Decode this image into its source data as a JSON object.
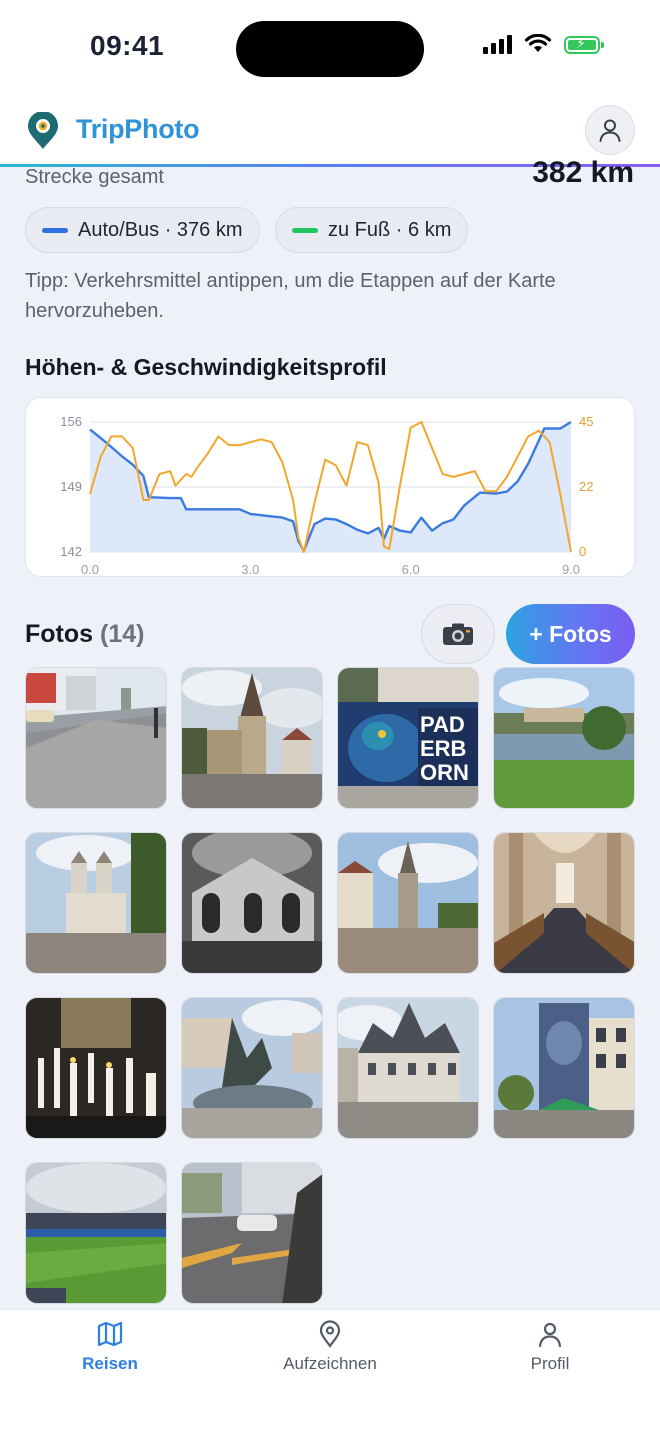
{
  "status_bar": {
    "time": "09:41"
  },
  "header": {
    "app_name": "TripPhoto"
  },
  "distance": {
    "label": "Strecke gesamt",
    "value": "382 km"
  },
  "modes": [
    {
      "label": "Auto/Bus · 376 km",
      "color": "#2f6fe0"
    },
    {
      "label": "zu Fuß · 6 km",
      "color": "#22c55e"
    }
  ],
  "tip": "Tipp: Verkehrsmittel antippen, um die Etappen auf der Karte hervorzuheben.",
  "profile": {
    "title": "Höhen- & Geschwindigkeitsprofil",
    "chart_data": {
      "type": "line",
      "x_ticks": [
        "0.0",
        "3.0",
        "6.0",
        "9.0"
      ],
      "y_left_ticks": [
        "156",
        "149",
        "142"
      ],
      "y_right_ticks": [
        "45",
        "22",
        "0"
      ],
      "xlim": [
        0,
        9
      ],
      "ylim_left": [
        142,
        156
      ],
      "ylim_right": [
        0,
        45
      ],
      "grid": true,
      "series": [
        {
          "axis": "left",
          "color": "#3b7be0",
          "fill": "#dde8fb",
          "x": [
            0.0,
            0.3,
            0.6,
            0.8,
            1.0,
            1.1,
            1.5,
            1.7,
            1.8,
            2.0,
            2.5,
            2.8,
            3.0,
            3.3,
            3.6,
            3.8,
            3.9,
            4.0,
            4.2,
            4.4,
            4.6,
            4.8,
            5.0,
            5.2,
            5.4,
            5.5,
            5.6,
            5.8,
            6.0,
            6.2,
            6.4,
            6.6,
            6.8,
            7.0,
            7.3,
            7.6,
            7.8,
            8.0,
            8.2,
            8.5,
            8.8,
            9.0
          ],
          "values": [
            155.2,
            153.8,
            152.3,
            151.4,
            150.2,
            147.9,
            147.8,
            147.8,
            146.6,
            146.6,
            146.6,
            146.6,
            146.1,
            145.9,
            145.7,
            145.3,
            143.2,
            142.1,
            145.0,
            145.6,
            145.5,
            145.0,
            144.4,
            144.0,
            144.6,
            143.4,
            144.8,
            144.3,
            144.1,
            145.7,
            144.3,
            145.1,
            145.5,
            147.0,
            148.4,
            148.3,
            148.5,
            149.6,
            151.5,
            155.3,
            155.3,
            156.0
          ]
        },
        {
          "axis": "right",
          "color": "#f2a72c",
          "x": [
            0.0,
            0.2,
            0.4,
            0.6,
            0.8,
            1.0,
            1.1,
            1.3,
            1.5,
            1.6,
            1.8,
            1.9,
            2.0,
            2.2,
            2.4,
            2.6,
            2.8,
            3.0,
            3.2,
            3.4,
            3.6,
            3.8,
            3.9,
            4.0,
            4.2,
            4.4,
            4.6,
            4.8,
            5.0,
            5.2,
            5.4,
            5.5,
            5.6,
            5.8,
            6.0,
            6.2,
            6.4,
            6.6,
            6.8,
            7.0,
            7.2,
            7.4,
            7.6,
            7.8,
            8.0,
            8.2,
            8.4,
            8.6,
            8.8,
            9.0
          ],
          "values": [
            20,
            33,
            40,
            40,
            36,
            18,
            18,
            27,
            28,
            23,
            27,
            26,
            29,
            34,
            40,
            37,
            37,
            38,
            39,
            38,
            31,
            18,
            5,
            0,
            17,
            32,
            30,
            23,
            38,
            37,
            24,
            2,
            1,
            23,
            43,
            45,
            36,
            27,
            26,
            27,
            28,
            21,
            21,
            26,
            33,
            40,
            42,
            38,
            20,
            0
          ]
        }
      ]
    }
  },
  "photos": {
    "title": "Fotos",
    "count": "(14)",
    "add_label": "+ Fotos",
    "items": [
      {
        "subject": "street-with-taxi"
      },
      {
        "subject": "church-tower"
      },
      {
        "subject": "mural-bird"
      },
      {
        "subject": "pond-park"
      },
      {
        "subject": "abbey-church"
      },
      {
        "subject": "bw-chapel"
      },
      {
        "subject": "town-square-church"
      },
      {
        "subject": "cathedral-nave"
      },
      {
        "subject": "candles"
      },
      {
        "subject": "fountain-statue"
      },
      {
        "subject": "town-hall"
      },
      {
        "subject": "building-mural"
      },
      {
        "subject": "stadium"
      },
      {
        "subject": "road-car"
      }
    ]
  },
  "tabs": [
    {
      "label": "Reisen",
      "icon": "map-icon",
      "active": true
    },
    {
      "label": "Aufzeichnen",
      "icon": "location-pin-icon",
      "active": false
    },
    {
      "label": "Profil",
      "icon": "user-icon",
      "active": false
    }
  ]
}
